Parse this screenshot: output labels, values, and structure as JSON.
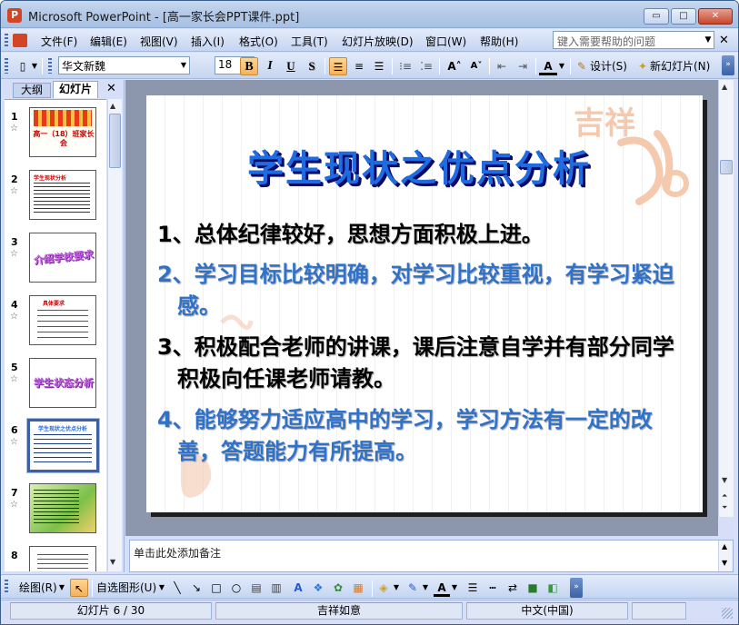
{
  "window": {
    "title": "Microsoft PowerPoint - [高一家长会PPT课件.ppt]",
    "app_icon_letter": "P",
    "min_glyph": "▭",
    "max_glyph": "□",
    "close_glyph": "✕"
  },
  "menu": {
    "items": [
      "文件(F)",
      "编辑(E)",
      "视图(V)",
      "插入(I)",
      "格式(O)",
      "工具(T)",
      "幻灯片放映(D)",
      "窗口(W)",
      "帮助(H)"
    ],
    "help_placeholder": "键入需要帮助的问题",
    "doc_close": "✕"
  },
  "toolbar": {
    "font_name": "华文新魏",
    "font_size": "18",
    "bold": "B",
    "italic": "I",
    "underline": "U",
    "shadow": "S",
    "grow": "A˄",
    "shrink": "A˅",
    "design_label": "设计(S)",
    "new_slide_label": "新幻灯片(N)"
  },
  "left_pane": {
    "tab_outline": "大纲",
    "tab_slides": "幻灯片",
    "close": "✕",
    "star": "☆",
    "thumbnails": [
      {
        "num": "1",
        "text": "高一（18）班家长会"
      },
      {
        "num": "2",
        "text": "学生现状分析"
      },
      {
        "num": "3",
        "text": "介绍学校要求"
      },
      {
        "num": "4",
        "text": "具体要求"
      },
      {
        "num": "5",
        "text": "学生状态分析"
      },
      {
        "num": "6",
        "text": "学生现状之优点分析"
      },
      {
        "num": "7",
        "text": ""
      },
      {
        "num": "8",
        "text": ""
      }
    ]
  },
  "slide": {
    "title": "学生现状之优点分析",
    "deco_text": "吉祥",
    "bullets": [
      {
        "text": "1、总体纪律较好，思想方面积极上进。",
        "color": "black"
      },
      {
        "text": "2、学习目标比较明确，对学习比较重视，有学习紧迫感。",
        "color": "blue"
      },
      {
        "text": "3、积极配合老师的讲课，课后注意自学并有部分同学积极向任课老师请教。",
        "color": "black"
      },
      {
        "text": "4、能够努力适应高中的学习，学习方法有一定的改善，答题能力有所提高。",
        "color": "blue"
      }
    ]
  },
  "notes": {
    "placeholder": "单击此处添加备注"
  },
  "drawbar": {
    "draw_label": "绘图(R)",
    "autoshapes_label": "自选图形(U)"
  },
  "status": {
    "slide_pos": "幻灯片 6 / 30",
    "design": "吉祥如意",
    "language": "中文(中国)"
  },
  "colors": {
    "title_blue": "#1f6be0",
    "bullet_blue": "#2f72c8",
    "accent_orange": "#f6b25b"
  }
}
